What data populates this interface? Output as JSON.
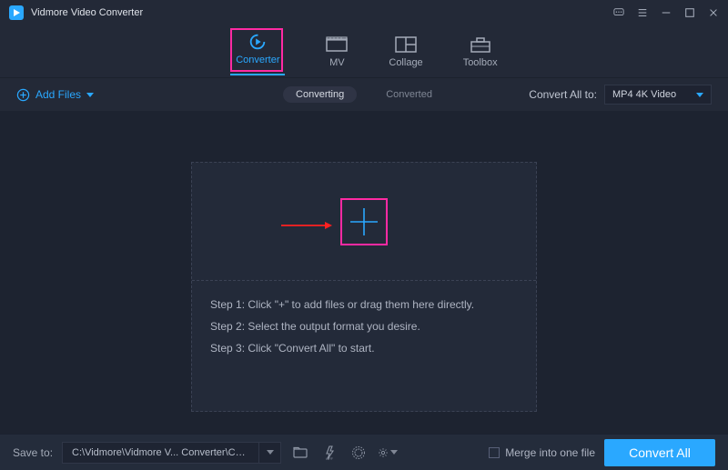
{
  "app": {
    "title": "Vidmore Video Converter"
  },
  "nav": {
    "items": [
      {
        "label": "Converter"
      },
      {
        "label": "MV"
      },
      {
        "label": "Collage"
      },
      {
        "label": "Toolbox"
      }
    ]
  },
  "toolbar": {
    "add_files": "Add Files",
    "tab_converting": "Converting",
    "tab_converted": "Converted",
    "convert_all_to_label": "Convert All to:",
    "format_selected": "MP4 4K Video"
  },
  "dropzone": {
    "step1": "Step 1: Click \"+\" to add files or drag them here directly.",
    "step2": "Step 2: Select the output format you desire.",
    "step3": "Step 3: Click \"Convert All\" to start."
  },
  "footer": {
    "save_to_label": "Save to:",
    "path": "C:\\Vidmore\\Vidmore V... Converter\\Converted",
    "merge_label": "Merge into one file",
    "convert_all_btn": "Convert All"
  }
}
